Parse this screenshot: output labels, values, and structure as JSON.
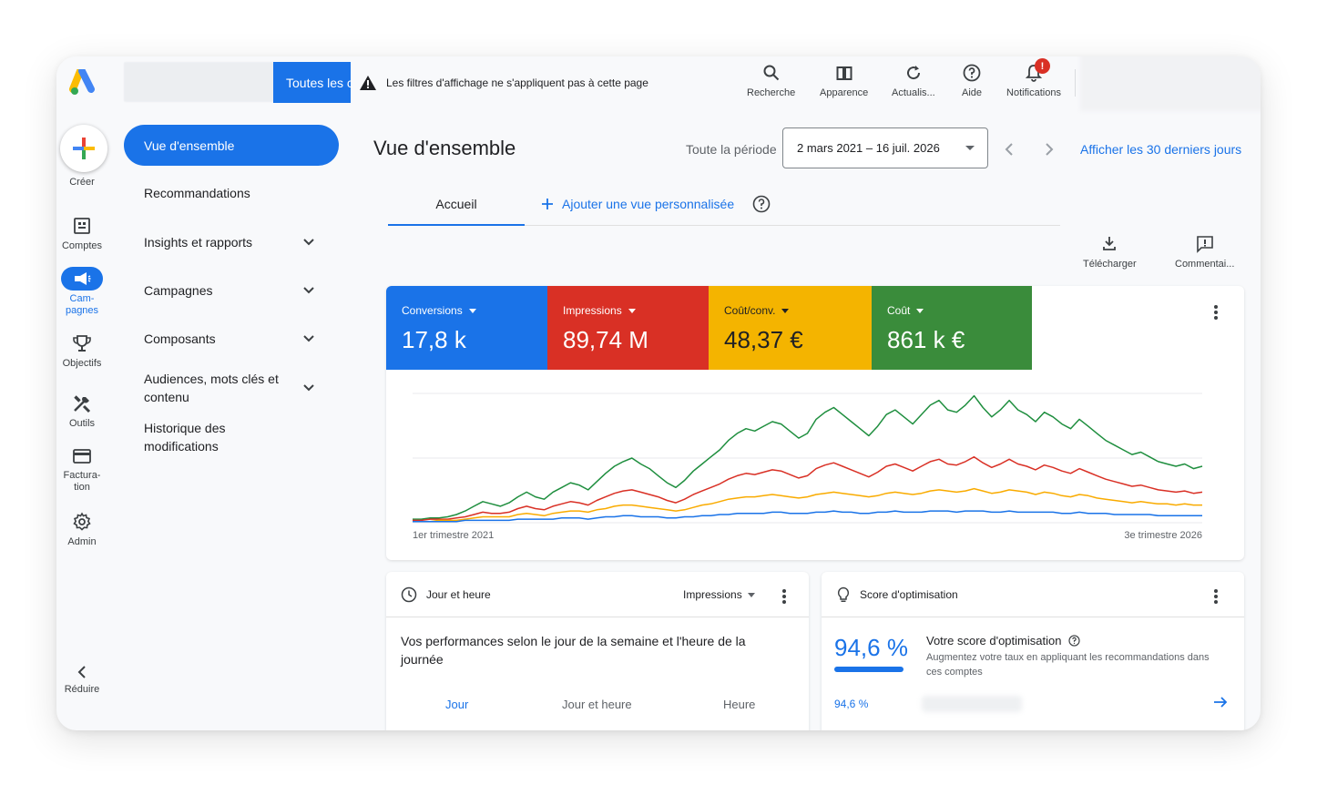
{
  "topbar": {
    "scope_button": "Toutes les c",
    "filter_warning": "Les filtres d'affichage ne s'appliquent pas à cette page",
    "icons": {
      "search": "Recherche",
      "appearance": "Apparence",
      "refresh": "Actualis...",
      "help": "Aide",
      "notifications": "Notifications",
      "notifications_badge": "!"
    }
  },
  "rail": {
    "create": "Créer",
    "accounts": "Comptes",
    "campaigns": "Cam-\npagnes",
    "goals": "Objectifs",
    "tools": "Outils",
    "billing": "Factura-\ntion",
    "admin": "Admin",
    "collapse": "Réduire"
  },
  "nav": {
    "items": [
      {
        "label": "Vue d'ensemble",
        "active": true
      },
      {
        "label": "Recommandations"
      },
      {
        "label": "Insights et rapports",
        "expandable": true
      },
      {
        "label": "Campagnes",
        "expandable": true
      },
      {
        "label": "Composants",
        "expandable": true
      },
      {
        "label": "Audiences, mots clés et contenu",
        "expandable": true
      },
      {
        "label": "Historique des modifications"
      }
    ]
  },
  "main": {
    "title": "Vue d'ensemble",
    "period_label": "Toute la période",
    "date_range": "2 mars 2021 – 16 juil. 2026",
    "last_days_link": "Afficher les 30 derniers jours",
    "tabs": {
      "home": "Accueil",
      "add_view": "Ajouter une vue personnalisée"
    },
    "actions": {
      "download": "Télécharger",
      "comments": "Commentai..."
    }
  },
  "metrics": [
    {
      "name": "Conversions",
      "value": "17,8 k",
      "color": "#1a73e8"
    },
    {
      "name": "Impressions",
      "value": "89,74 M",
      "color": "#d93025"
    },
    {
      "name": "Coût/conv.",
      "value": "48,37 €",
      "color": "#f9ab00"
    },
    {
      "name": "Coût",
      "value": "861 k €",
      "color": "#1e8e3e"
    }
  ],
  "chart_data": {
    "type": "line",
    "x_start_label": "1er trimestre 2021",
    "x_end_label": "3e trimestre 2026",
    "series": [
      {
        "name": "Coût",
        "color": "#1e8e3e",
        "values": [
          3,
          3,
          4,
          4,
          5,
          7,
          10,
          14,
          18,
          16,
          14,
          17,
          22,
          26,
          22,
          20,
          26,
          30,
          34,
          32,
          28,
          35,
          42,
          48,
          52,
          55,
          50,
          46,
          40,
          34,
          30,
          36,
          44,
          50,
          56,
          62,
          70,
          76,
          80,
          78,
          82,
          86,
          84,
          78,
          72,
          76,
          88,
          94,
          98,
          92,
          86,
          80,
          74,
          82,
          92,
          96,
          90,
          84,
          92,
          100,
          104,
          96,
          94,
          100,
          108,
          98,
          90,
          96,
          104,
          96,
          92,
          86,
          94,
          90,
          84,
          80,
          88,
          82,
          76,
          70,
          66,
          62,
          58,
          60,
          56,
          52,
          50,
          48,
          50,
          46,
          48
        ]
      },
      {
        "name": "Impressions",
        "color": "#d93025",
        "values": [
          2,
          2,
          3,
          3,
          3,
          4,
          5,
          7,
          9,
          8,
          8,
          9,
          12,
          14,
          12,
          11,
          14,
          16,
          18,
          17,
          15,
          19,
          22,
          25,
          27,
          28,
          26,
          24,
          22,
          19,
          17,
          20,
          24,
          27,
          30,
          33,
          37,
          40,
          42,
          41,
          43,
          45,
          44,
          41,
          38,
          40,
          46,
          49,
          51,
          48,
          45,
          42,
          39,
          43,
          48,
          50,
          47,
          44,
          48,
          52,
          54,
          50,
          49,
          52,
          56,
          51,
          47,
          50,
          54,
          50,
          48,
          45,
          49,
          47,
          44,
          42,
          46,
          43,
          40,
          37,
          35,
          33,
          31,
          32,
          30,
          28,
          27,
          26,
          27,
          25,
          26
        ]
      },
      {
        "name": "Coût/conv.",
        "color": "#f9ab00",
        "values": [
          1,
          1,
          1,
          2,
          2,
          2,
          3,
          4,
          5,
          5,
          5,
          5,
          7,
          8,
          7,
          6,
          8,
          9,
          10,
          10,
          9,
          11,
          12,
          14,
          15,
          15,
          14,
          13,
          12,
          11,
          10,
          11,
          13,
          15,
          16,
          18,
          20,
          21,
          22,
          22,
          23,
          24,
          23,
          22,
          21,
          22,
          24,
          25,
          26,
          25,
          24,
          23,
          22,
          23,
          25,
          26,
          25,
          24,
          25,
          27,
          28,
          27,
          26,
          27,
          29,
          27,
          25,
          26,
          28,
          27,
          26,
          24,
          26,
          25,
          23,
          22,
          24,
          23,
          21,
          20,
          19,
          18,
          17,
          18,
          17,
          16,
          16,
          15,
          16,
          15,
          15
        ]
      },
      {
        "name": "Conversions",
        "color": "#1a73e8",
        "values": [
          1,
          1,
          1,
          1,
          1,
          1,
          2,
          2,
          2,
          2,
          2,
          2,
          3,
          3,
          3,
          3,
          3,
          4,
          4,
          4,
          3,
          4,
          5,
          5,
          6,
          6,
          5,
          5,
          5,
          4,
          4,
          5,
          5,
          6,
          6,
          7,
          7,
          8,
          8,
          8,
          8,
          9,
          9,
          8,
          8,
          8,
          9,
          9,
          10,
          9,
          9,
          8,
          8,
          9,
          9,
          10,
          9,
          9,
          9,
          10,
          10,
          10,
          9,
          10,
          10,
          10,
          9,
          9,
          10,
          9,
          9,
          9,
          9,
          9,
          8,
          8,
          9,
          8,
          8,
          8,
          7,
          7,
          7,
          7,
          7,
          6,
          6,
          6,
          6,
          6,
          6
        ]
      }
    ],
    "ylim": [
      0,
      110
    ],
    "grid": true
  },
  "day_card": {
    "title": "Jour et heure",
    "metric_select": "Impressions",
    "description": "Vos performances selon le jour de la semaine et l'heure de la journée",
    "tabs": [
      "Jour",
      "Jour et heure",
      "Heure"
    ]
  },
  "score_card": {
    "title": "Score d'optimisation",
    "score": "94,6 %",
    "score_fraction": 0.946,
    "heading": "Votre score d'optimisation",
    "description": "Augmentez votre taux en appliquant les recommandations dans ces comptes",
    "score_small": "94,6 %"
  }
}
